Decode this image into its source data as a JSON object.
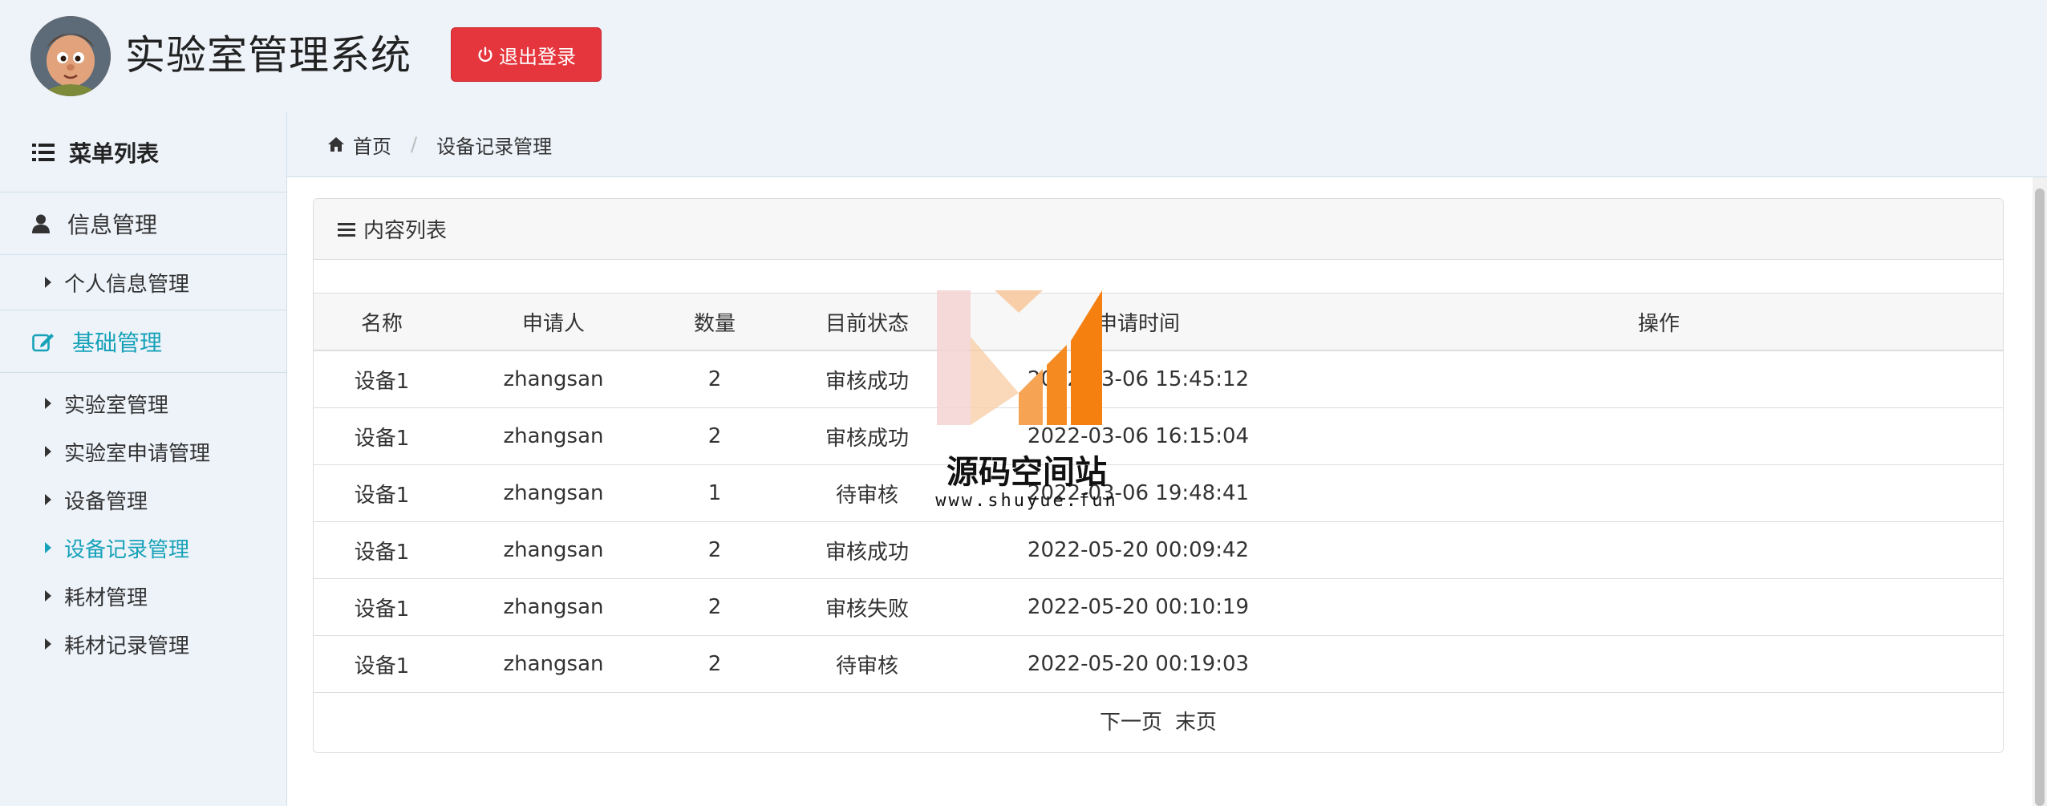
{
  "header": {
    "title": "实验室管理系统",
    "logout_label": "退出登录",
    "colors": {
      "logout_bg": "#e5363e"
    }
  },
  "sidebar": {
    "title": "菜单列表",
    "groups": [
      {
        "label": "信息管理",
        "icon": "user-icon",
        "active": false,
        "items": [
          {
            "label": "个人信息管理",
            "active": false
          }
        ]
      },
      {
        "label": "基础管理",
        "icon": "edit-icon",
        "active": true,
        "items": [
          {
            "label": "实验室管理",
            "active": false
          },
          {
            "label": "实验室申请管理",
            "active": false
          },
          {
            "label": "设备管理",
            "active": false
          },
          {
            "label": "设备记录管理",
            "active": true
          },
          {
            "label": "耗材管理",
            "active": false
          },
          {
            "label": "耗材记录管理",
            "active": false
          }
        ]
      }
    ],
    "accent_color": "#17a2b8"
  },
  "breadcrumb": {
    "home": "首页",
    "current": "设备记录管理"
  },
  "panel": {
    "title": "内容列表",
    "columns": [
      "名称",
      "申请人",
      "数量",
      "目前状态",
      "申请时间",
      "操作"
    ],
    "rows": [
      [
        "设备1",
        "zhangsan",
        "2",
        "审核成功",
        "2022-03-06 15:45:12",
        ""
      ],
      [
        "设备1",
        "zhangsan",
        "2",
        "审核成功",
        "2022-03-06 16:15:04",
        ""
      ],
      [
        "设备1",
        "zhangsan",
        "1",
        "待审核",
        "2022-03-06 19:48:41",
        ""
      ],
      [
        "设备1",
        "zhangsan",
        "2",
        "审核成功",
        "2022-05-20 00:09:42",
        ""
      ],
      [
        "设备1",
        "zhangsan",
        "2",
        "审核失败",
        "2022-05-20 00:10:19",
        ""
      ],
      [
        "设备1",
        "zhangsan",
        "2",
        "待审核",
        "2022-05-20 00:19:03",
        ""
      ]
    ],
    "pager": {
      "next": "下一页",
      "last": "末页"
    }
  },
  "watermark": {
    "name": "源码空间站",
    "url": "www.shuyue.fun"
  }
}
